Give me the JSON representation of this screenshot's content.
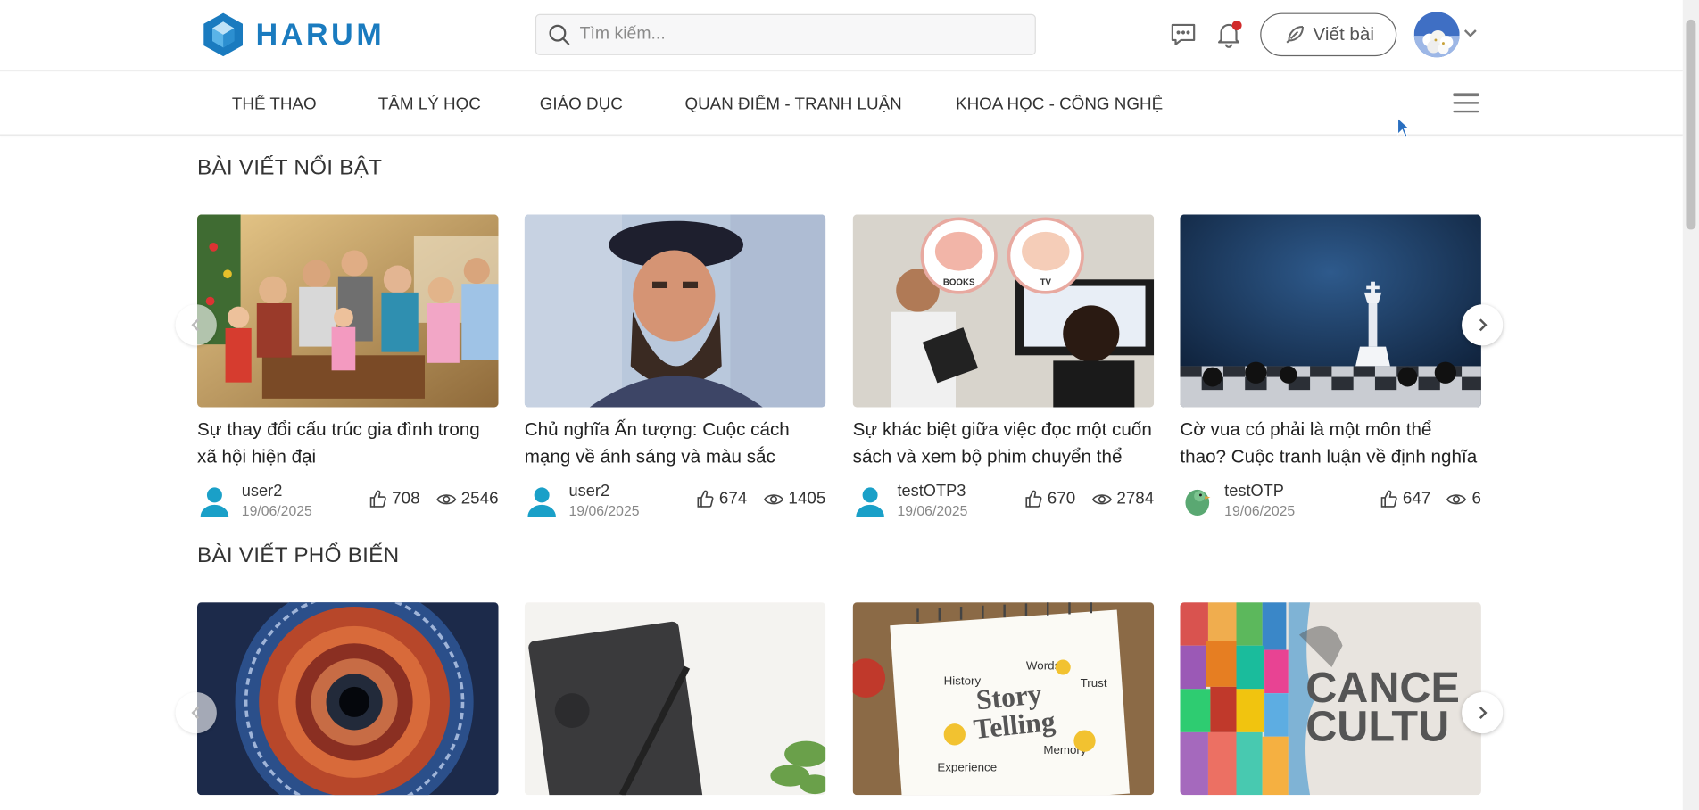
{
  "brand": {
    "name": "HARUM",
    "color": "#1a7bbf"
  },
  "search": {
    "placeholder": "Tìm kiếm..."
  },
  "header": {
    "write_label": "Viết bài",
    "icons": [
      "chat-icon",
      "bell-icon",
      "feather-icon",
      "chevron-down-icon"
    ]
  },
  "nav": {
    "items": [
      {
        "label": "THỂ THAO"
      },
      {
        "label": "TÂM LÝ HỌC"
      },
      {
        "label": "GIÁO DỤC"
      },
      {
        "label": "QUAN ĐIỂM - TRANH LUẬN"
      },
      {
        "label": "KHOA HỌC - CÔNG NGHỆ"
      }
    ]
  },
  "featured": {
    "title": "BÀI VIẾT NỔI BẬT",
    "cards": [
      {
        "title": "Sự thay đổi cấu trúc gia đình trong xã hội hiện đại",
        "author": "user2",
        "date": "19/06/2025",
        "likes": "708",
        "views": "2546",
        "image": "family-photo"
      },
      {
        "title": "Chủ nghĩa Ấn tượng: Cuộc cách mạng về ánh sáng và màu sắc",
        "author": "user2",
        "date": "19/06/2025",
        "likes": "674",
        "views": "1405",
        "image": "painted-portrait"
      },
      {
        "title": "Sự khác biệt giữa việc đọc một cuốn sách và xem bộ phim chuyển thể",
        "author": "testOTP3",
        "date": "19/06/2025",
        "likes": "670",
        "views": "2784",
        "image": "books-vs-tv"
      },
      {
        "title": "Cờ vua có phải là một môn thể thao? Cuộc tranh luận về định nghĩa",
        "author": "testOTP",
        "date": "19/06/2025",
        "likes": "647",
        "views": "6",
        "image": "chess-king"
      }
    ],
    "image_labels": {
      "books": "BOOKS",
      "tv": "TV"
    }
  },
  "popular": {
    "title": "BÀI VIẾT PHỔ BIẾN",
    "cards": [
      {
        "image": "particle-detector"
      },
      {
        "image": "notebook-pen"
      },
      {
        "image": "story-telling-notepad"
      },
      {
        "image": "cancel-culture"
      }
    ],
    "image_texts": {
      "story1": "Story",
      "story2": "Telling",
      "history": "History",
      "words": "Words",
      "trust": "Trust",
      "memory": "Memory",
      "experience": "Experience",
      "cancel1": "CANCE",
      "cancel2": "CULTU"
    }
  }
}
